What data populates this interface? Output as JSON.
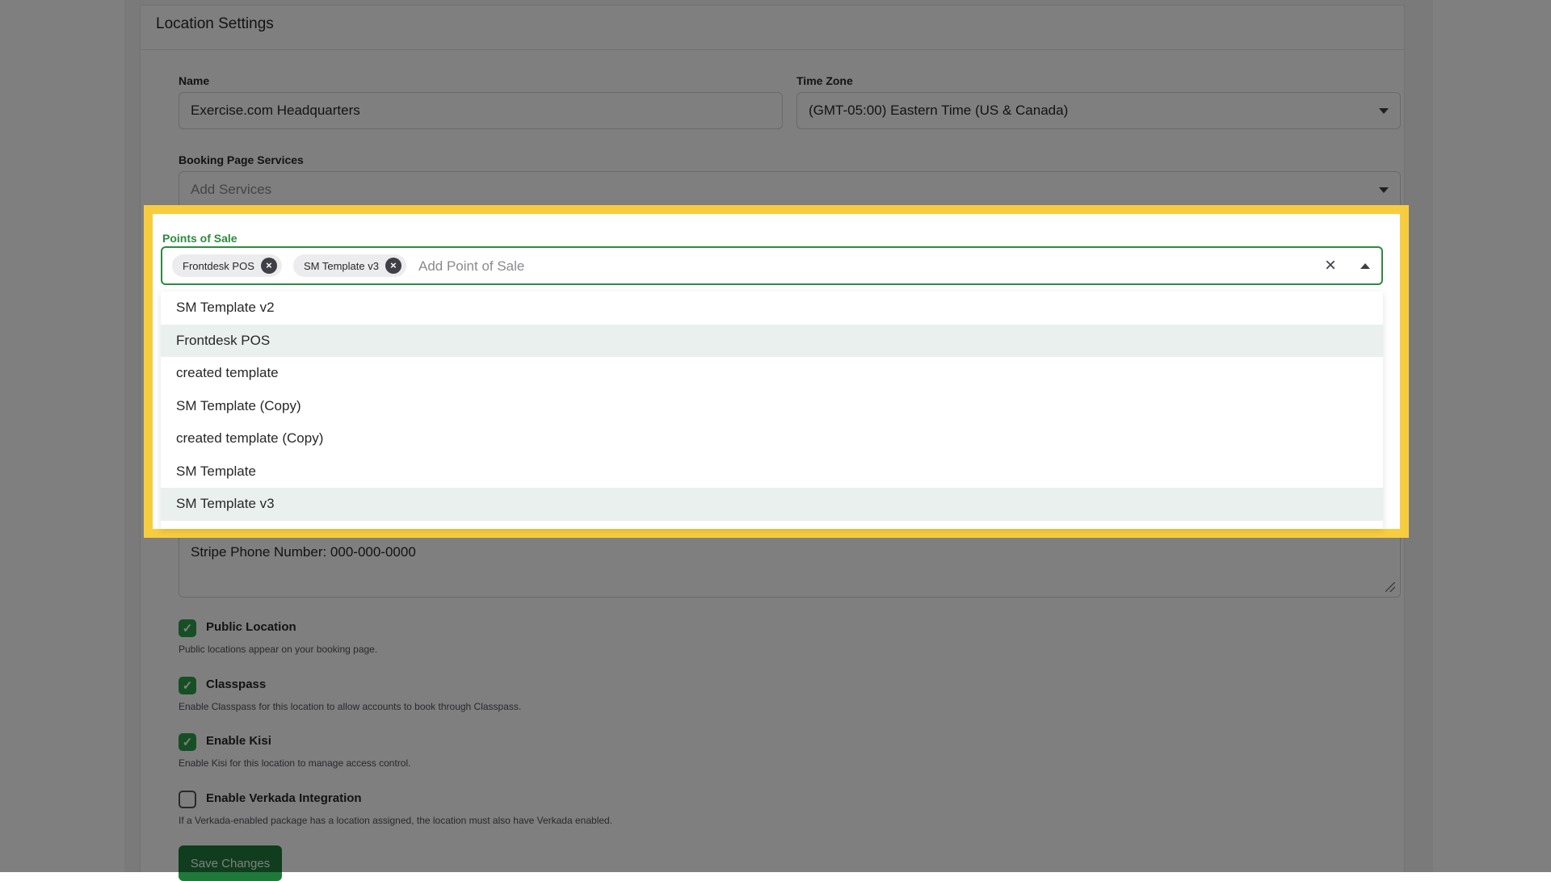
{
  "card": {
    "title": "Location Settings"
  },
  "name": {
    "label": "Name",
    "value": "Exercise.com Headquarters"
  },
  "time_zone": {
    "label": "Time Zone",
    "value": "(GMT-05:00) Eastern Time (US & Canada)"
  },
  "booking_services": {
    "label": "Booking Page Services",
    "placeholder": "Add Services"
  },
  "points_of_sale": {
    "label": "Points of Sale",
    "chips": [
      "Frontdesk POS",
      "SM Template v3"
    ],
    "placeholder": "Add Point of Sale",
    "options": [
      {
        "label": "SM Template v2",
        "selected": false
      },
      {
        "label": "Frontdesk POS",
        "selected": true
      },
      {
        "label": "created template",
        "selected": false
      },
      {
        "label": "SM Template (Copy)",
        "selected": false
      },
      {
        "label": "created template (Copy)",
        "selected": false
      },
      {
        "label": "SM Template",
        "selected": false
      },
      {
        "label": "SM Template v3",
        "selected": true
      }
    ]
  },
  "description": {
    "visible_line": "Stripe Phone Number: 000-000-0000"
  },
  "checkboxes": [
    {
      "label": "Public Location",
      "help": "Public locations appear on your booking page.",
      "checked": true
    },
    {
      "label": "Classpass",
      "help": "Enable Classpass for this location to allow accounts to book through Classpass.",
      "checked": true
    },
    {
      "label": "Enable Kisi",
      "help": "Enable Kisi for this location to manage access control.",
      "checked": true
    },
    {
      "label": "Enable Verkada Integration",
      "help": "If a Verkada-enabled package has a location assigned, the location must also have Verkada enabled.",
      "checked": false
    }
  ],
  "save_button": {
    "label": "Save Changes"
  },
  "colors": {
    "accent_green": "#2d8a3f",
    "highlight_yellow": "#f7cc3f",
    "button_green": "#1f7a3a"
  }
}
